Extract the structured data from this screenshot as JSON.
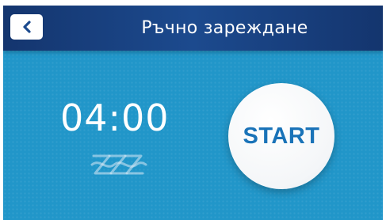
{
  "header": {
    "title": "Ръчно зареждане",
    "back_icon": "chevron-left-icon"
  },
  "timer": {
    "value": "04:00"
  },
  "status_icon": "heating-disabled-icon",
  "start_button": {
    "label": "START"
  },
  "colors": {
    "header_bg": "#1c4a8e",
    "screen_bg": "#2196c9",
    "accent_text": "#1a73b8",
    "button_bg": "#ffffff"
  }
}
